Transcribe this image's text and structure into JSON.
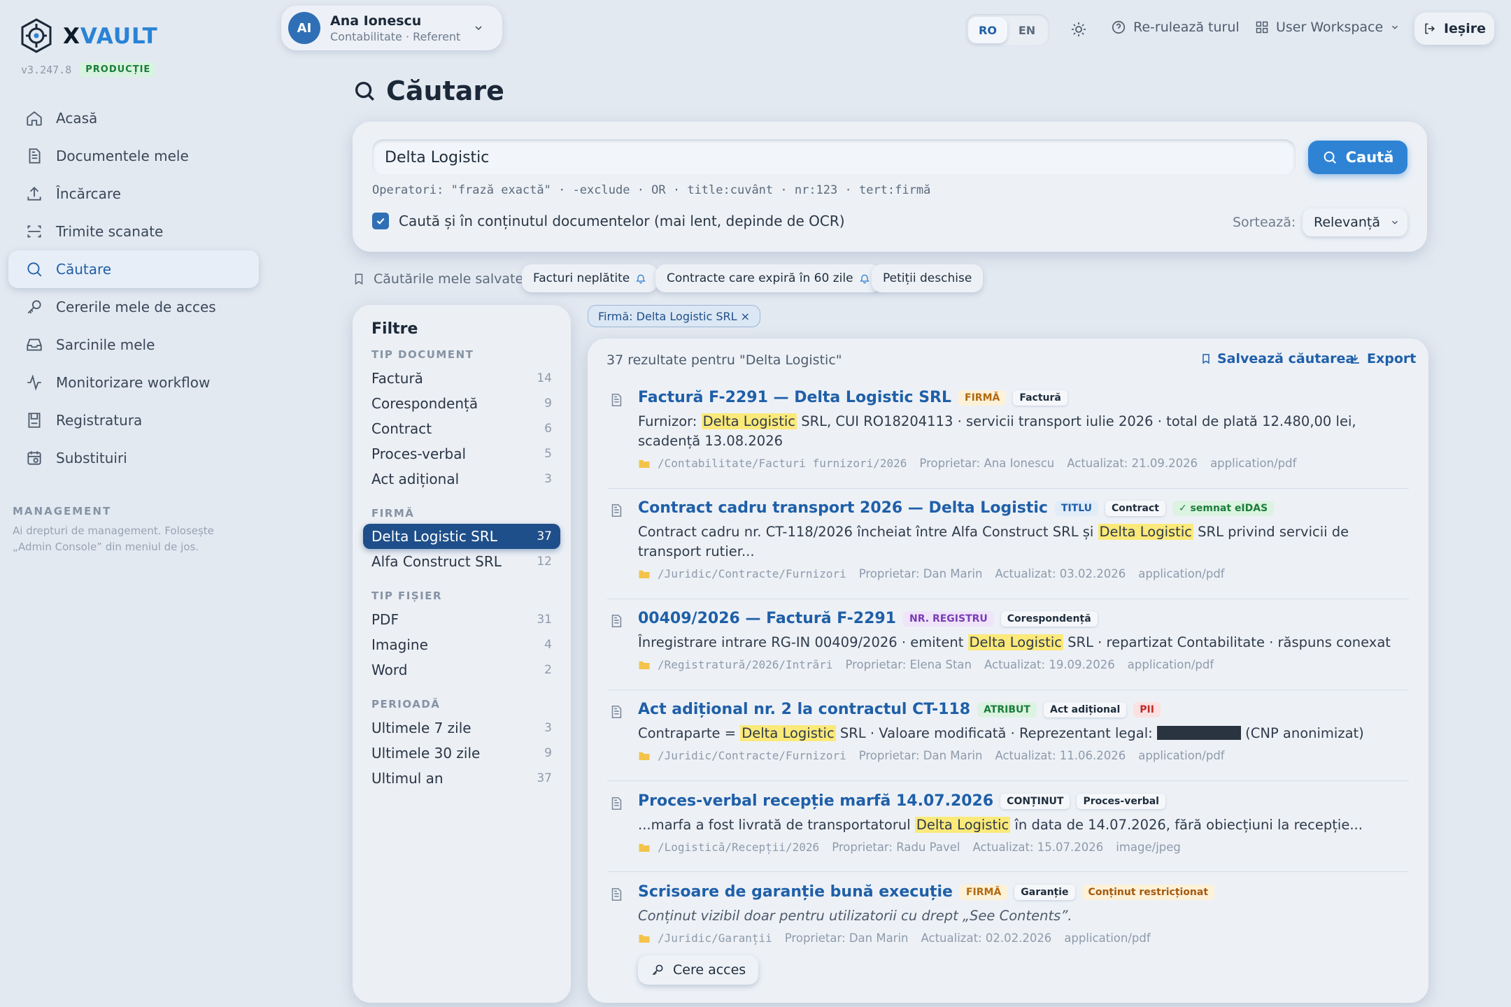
{
  "app": {
    "name_prefix": "X",
    "name_suffix": "VAULT",
    "version": "v3.247.8",
    "env_badge": "PRODUCȚIE"
  },
  "sidebar": {
    "items": [
      {
        "label": "Acasă",
        "icon": "home-icon"
      },
      {
        "label": "Documentele mele",
        "icon": "document-icon"
      },
      {
        "label": "Încărcare",
        "icon": "upload-icon"
      },
      {
        "label": "Trimite scanate",
        "icon": "scan-icon"
      },
      {
        "label": "Căutare",
        "icon": "search-icon",
        "active": true
      },
      {
        "label": "Cererile mele de acces",
        "icon": "key-icon"
      },
      {
        "label": "Sarcinile mele",
        "icon": "inbox-icon"
      },
      {
        "label": "Monitorizare workflow",
        "icon": "activity-icon"
      },
      {
        "label": "Registratura",
        "icon": "register-icon"
      },
      {
        "label": "Substituiri",
        "icon": "calendar-icon"
      }
    ],
    "management_title": "MANAGEMENT",
    "management_text": "Ai drepturi de management. Folosește „Admin Console” din meniul de jos."
  },
  "topbar": {
    "user_initials": "AI",
    "user_name": "Ana Ionescu",
    "user_role": "Contabilitate · Referent",
    "lang_ro": "RO",
    "lang_en": "EN",
    "rerun_label": "Re-rulează turul",
    "workspace_label": "User Workspace",
    "logout_label": "Ieșire"
  },
  "page": {
    "title": "Căutare"
  },
  "search": {
    "query": "Delta Logistic",
    "button_label": "Caută",
    "operators_hint": "Operatori: \"frază exactă\" · -exclude · OR · title:cuvânt · nr:123 · tert:firmă",
    "ocr_label": "Caută și în conținutul documentelor (mai lent, depinde de OCR)",
    "ocr_checked": true,
    "sort_label": "Sortează:",
    "sort_value": "Relevanță"
  },
  "saved": {
    "label": "Căutările mele salvate:",
    "chips": [
      "Facturi neplătite",
      "Contracte care expiră în 60 zile",
      "Petiții deschise"
    ]
  },
  "filters": {
    "title": "Filtre",
    "sections": [
      {
        "title": "TIP DOCUMENT",
        "rows": [
          {
            "label": "Factură",
            "count": "14"
          },
          {
            "label": "Corespondență",
            "count": "9"
          },
          {
            "label": "Contract",
            "count": "6"
          },
          {
            "label": "Proces-verbal",
            "count": "5"
          },
          {
            "label": "Act adițional",
            "count": "3"
          }
        ]
      },
      {
        "title": "FIRMĂ",
        "rows": [
          {
            "label": "Delta Logistic SRL",
            "count": "37",
            "selected": true
          },
          {
            "label": "Alfa Construct SRL",
            "count": "12"
          }
        ]
      },
      {
        "title": "TIP FIȘIER",
        "rows": [
          {
            "label": "PDF",
            "count": "31"
          },
          {
            "label": "Imagine",
            "count": "4"
          },
          {
            "label": "Word",
            "count": "2"
          }
        ]
      },
      {
        "title": "PERIOADĂ",
        "rows": [
          {
            "label": "Ultimele 7 zile",
            "count": "3"
          },
          {
            "label": "Ultimele 30 zile",
            "count": "9"
          },
          {
            "label": "Ultimul an",
            "count": "37"
          }
        ]
      }
    ]
  },
  "active_filter": "Firmă: Delta Logistic SRL ×",
  "results": {
    "count_text": "37 rezultate pentru \"Delta Logistic\"",
    "save_label": "Salvează căutarea",
    "export_label": "Export",
    "highlight": "Delta Logistic",
    "items": [
      {
        "title": "Factură F-2291 — Delta Logistic SRL",
        "tags": [
          {
            "text": "FIRMĂ",
            "kind": "t-firma"
          },
          {
            "text": "Factură",
            "kind": "plain"
          }
        ],
        "snippet_pre": "Furnizor: ",
        "snippet_hl": "Delta Logistic",
        "snippet_post": " SRL, CUI RO18204113 · servicii transport iulie 2026 · total de plată 12.480,00 lei, scadență 13.08.2026",
        "path": "/Contabilitate/Facturi furnizori/2026",
        "owner": "Proprietar: Ana Ionescu",
        "updated": "Actualizat: 21.09.2026",
        "mime": "application/pdf"
      },
      {
        "title": "Contract cadru transport 2026 — Delta Logistic",
        "tags": [
          {
            "text": "TITLU",
            "kind": "t-titlu"
          },
          {
            "text": "Contract",
            "kind": "plain"
          },
          {
            "text": "✓ semnat eIDAS",
            "kind": "t-eidas"
          }
        ],
        "snippet_pre": "Contract cadru nr. CT-118/2026 încheiat între Alfa Construct SRL și ",
        "snippet_hl": "Delta Logistic",
        "snippet_post": " SRL privind servicii de transport rutier...",
        "path": "/Juridic/Contracte/Furnizori",
        "owner": "Proprietar: Dan Marin",
        "updated": "Actualizat: 03.02.2026",
        "mime": "application/pdf"
      },
      {
        "title": "00409/2026 — Factură F-2291",
        "tags": [
          {
            "text": "NR. REGISTRU",
            "kind": "t-nrreg"
          },
          {
            "text": "Corespondență",
            "kind": "plain"
          }
        ],
        "snippet_pre": "Înregistrare intrare RG-IN 00409/2026 · emitent ",
        "snippet_hl": "Delta Logistic",
        "snippet_post": " SRL · repartizat Contabilitate · răspuns conexat",
        "path": "/Registratură/2026/Intrări",
        "owner": "Proprietar: Elena Stan",
        "updated": "Actualizat: 19.09.2026",
        "mime": "application/pdf"
      },
      {
        "title": "Act adițional nr. 2 la contractul CT-118",
        "tags": [
          {
            "text": "ATRIBUT",
            "kind": "t-atribut"
          },
          {
            "text": "Act adițional",
            "kind": "plain"
          },
          {
            "text": "PII",
            "kind": "t-pii"
          }
        ],
        "snippet_pre": "Contraparte = ",
        "snippet_hl": "Delta Logistic",
        "snippet_post": " SRL · Valoare modificată · Reprezentant legal: ",
        "snippet_tail": " (CNP anonimizat)",
        "path": "/Juridic/Contracte/Furnizori",
        "owner": "Proprietar: Dan Marin",
        "updated": "Actualizat: 11.06.2026",
        "mime": "application/pdf"
      },
      {
        "title": "Proces-verbal recepție marfă 14.07.2026",
        "tags": [
          {
            "text": "CONȚINUT",
            "kind": "t-continut"
          },
          {
            "text": "Proces-verbal",
            "kind": "plain"
          }
        ],
        "snippet_pre": "...marfa a fost livrată de transportatorul ",
        "snippet_hl": "Delta Logistic",
        "snippet_post": " în data de 14.07.2026, fără obiecțiuni la recepție...",
        "path": "/Logistică/Recepții/2026",
        "owner": "Proprietar: Radu Pavel",
        "updated": "Actualizat: 15.07.2026",
        "mime": "image/jpeg"
      },
      {
        "title": "Scrisoare de garanție bună execuție",
        "tags": [
          {
            "text": "FIRMĂ",
            "kind": "t-firma"
          },
          {
            "text": "Garanție",
            "kind": "plain"
          },
          {
            "text": "Conținut restricționat",
            "kind": "t-restr"
          }
        ],
        "snippet_italic": "Conținut vizibil doar pentru utilizatorii cu drept „See Contents”.",
        "path": "/Juridic/Garanții",
        "owner": "Proprietar: Dan Marin",
        "updated": "Actualizat: 02.02.2026",
        "mime": "application/pdf",
        "request_label": "Cere acces"
      }
    ]
  },
  "colors": {
    "accent": "#2f83d4",
    "brand": "#2a83d6",
    "selected_filter": "#1f4f8a",
    "highlight": "#fbe97a"
  }
}
